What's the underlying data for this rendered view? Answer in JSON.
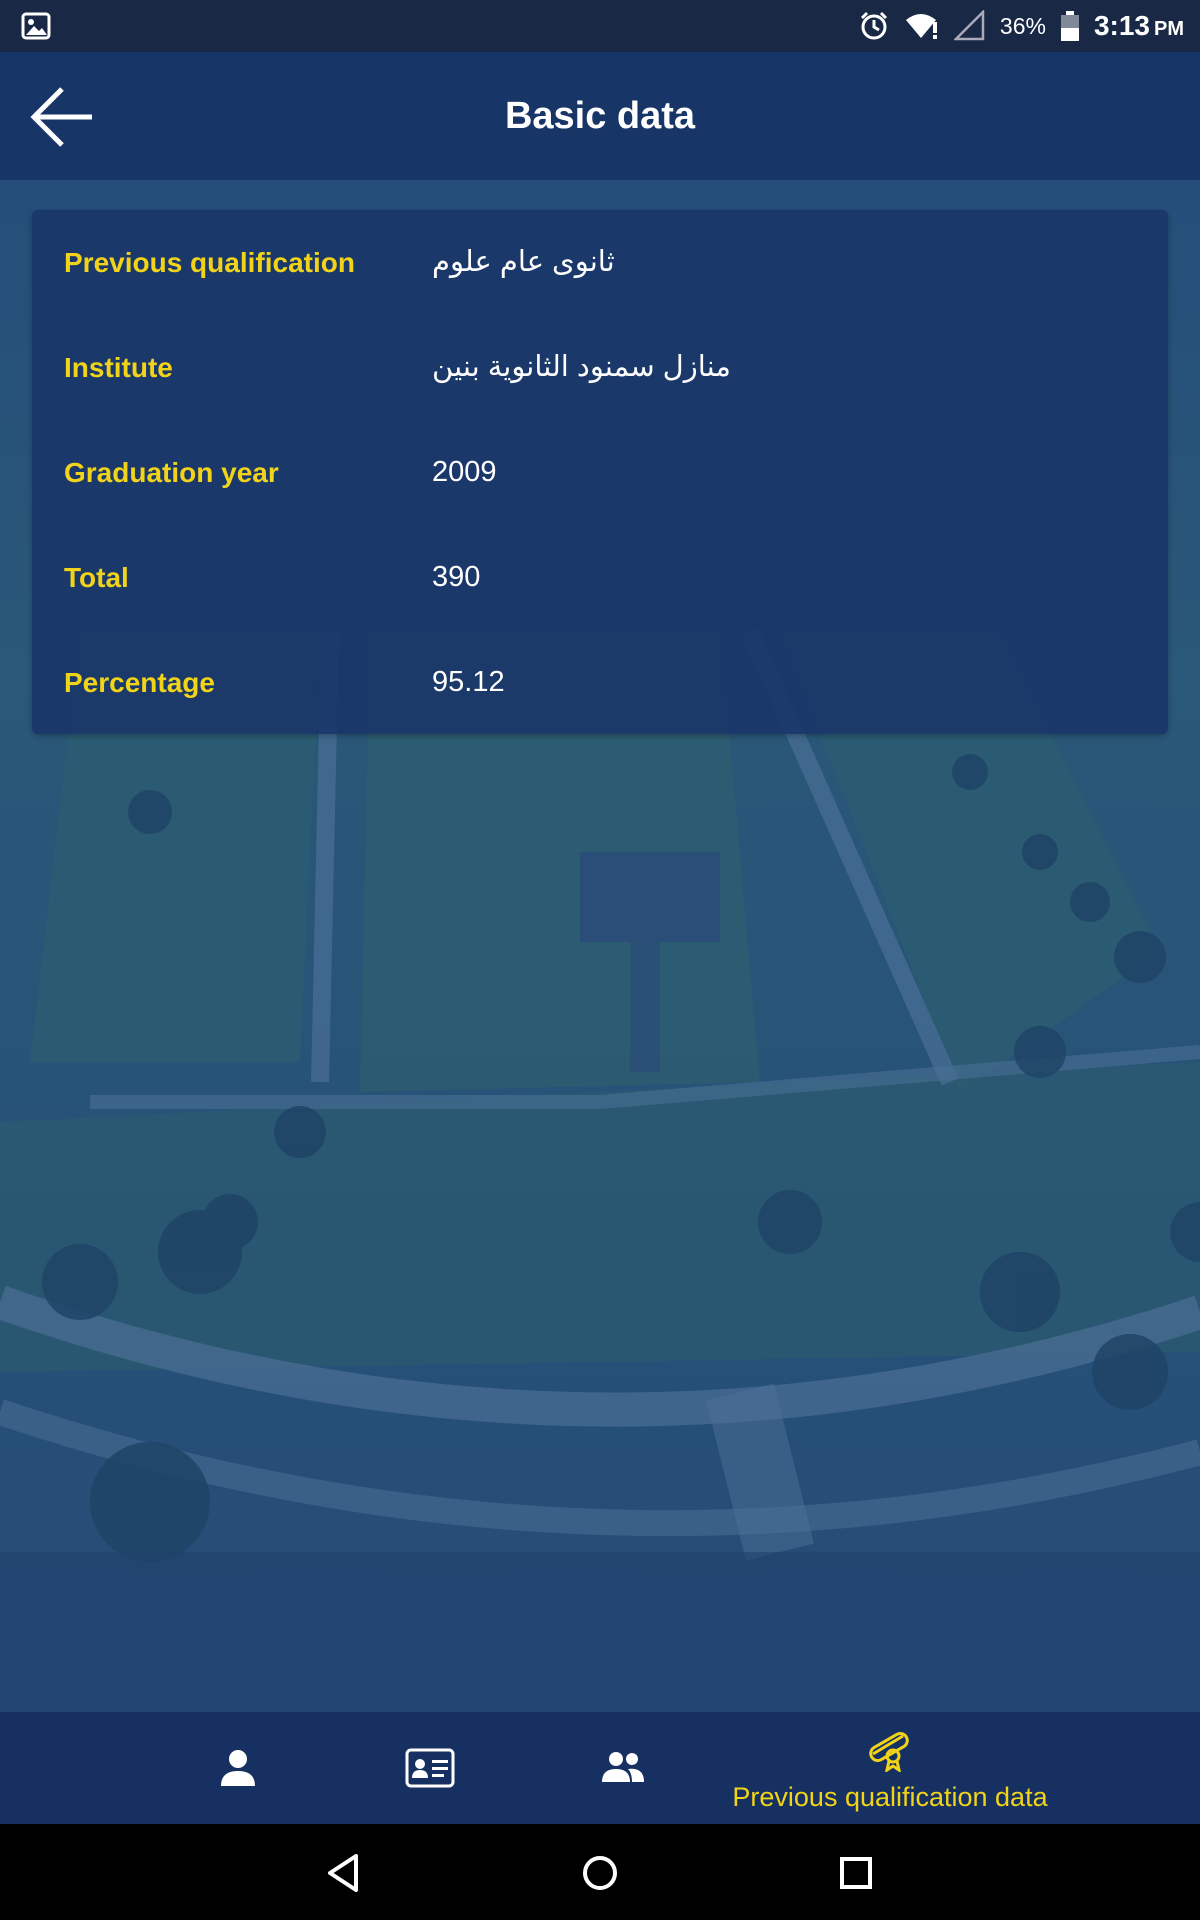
{
  "status_bar": {
    "battery": "36%",
    "time": "3:13",
    "ampm": "PM",
    "icons": [
      "image-icon",
      "alarm-icon",
      "wifi-alert-icon",
      "signal-icon",
      "battery-icon"
    ]
  },
  "app_bar": {
    "title": "Basic data",
    "back_icon": "arrow-back-icon"
  },
  "details": {
    "rows": [
      {
        "label": "Previous qualification",
        "value": "ثانوى عام علوم"
      },
      {
        "label": "Institute",
        "value": "منازل سمنود الثانوية بنين"
      },
      {
        "label": "Graduation year",
        "value": "2009"
      },
      {
        "label": "Total",
        "value": "390"
      },
      {
        "label": "Percentage",
        "value": "95.12"
      }
    ]
  },
  "bottom_nav": {
    "items": [
      {
        "icon": "person-icon",
        "label": ""
      },
      {
        "icon": "id-card-icon",
        "label": ""
      },
      {
        "icon": "group-icon",
        "label": ""
      },
      {
        "icon": "diploma-icon",
        "label": "Previous qualification data",
        "active": true
      }
    ]
  },
  "system_nav": {
    "buttons": [
      "back-triangle-icon",
      "home-circle-icon",
      "recents-square-icon"
    ]
  },
  "colors": {
    "accent": "#f1d319",
    "primary": "#1a3568",
    "status_bar": "#182845"
  }
}
